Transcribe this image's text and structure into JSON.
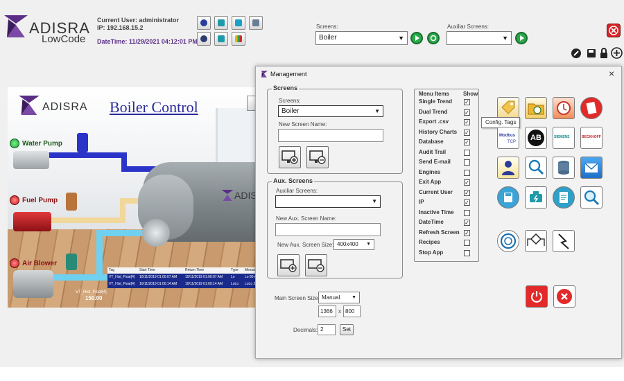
{
  "header": {
    "logo_text": "ADISRA",
    "logo_sub": "LowCode",
    "current_user": "Current User: administrator",
    "ip": "IP: 192.168.15.2",
    "datetime": "DateTime: 11/29/2021 04:12:01 PM"
  },
  "screens": {
    "label": "Screens:",
    "value": "Boiler"
  },
  "aux_screens": {
    "label": "Auxiliar Screens:",
    "value": ""
  },
  "canvas": {
    "logo_text": "ADISRA",
    "title": "Boiler Control",
    "water_pump": "Water Pump",
    "fuel_pump": "Fuel Pump",
    "air_blower": "Air Blower",
    "tank_logo": "ADIS",
    "table": {
      "headers": [
        "Tag",
        "Start Time",
        "Return Time",
        "Type",
        "Messa"
      ],
      "rows": [
        [
          "VT_Hist_Float[4]",
          "10/11/2019 01:00:07 AM",
          "10/11/2019 01:00:07 AM",
          "Lo",
          "Lo 80 A"
        ],
        [
          "VT_Hist_Float[4]",
          "10/11/2019 01:00:14 AM",
          "10/11/2019 01:00:14 AM",
          "LoLo",
          "LoLo 25"
        ]
      ]
    },
    "readout_tag": "VT_Hist_Float[4]",
    "readout_value": "150.00"
  },
  "dialog": {
    "title": "Management",
    "close": "×",
    "screens_group": {
      "title": "Screens",
      "label": "Screens:",
      "value": "Boiler",
      "new_name_label": "New Screen Name:",
      "new_name_value": ""
    },
    "aux_group": {
      "title": "Aux. Screens",
      "label": "Auxiliar Screens:",
      "value": "",
      "new_name_label": "New Aux. Screen Name:",
      "new_name_value": "",
      "size_label": "New Aux. Screen Size:",
      "size_value": "400x400"
    },
    "menu": {
      "header_items": "Menu Items",
      "header_show": "Show",
      "items": [
        {
          "label": "Single Trend",
          "mark": "✓"
        },
        {
          "label": "Dual Trend",
          "mark": "✓"
        },
        {
          "label": "Export .csv",
          "mark": "✓"
        },
        {
          "label": "History Charts",
          "mark": "✓"
        },
        {
          "label": "Database",
          "mark": "✓"
        },
        {
          "label": "Audit Trail",
          "mark": ""
        },
        {
          "label": "Send E-mail",
          "mark": ""
        },
        {
          "label": "Engines",
          "mark": ""
        },
        {
          "label": "Exit App",
          "mark": "✓"
        },
        {
          "label": "Current User",
          "mark": "✓"
        },
        {
          "label": "IP",
          "mark": "✓"
        },
        {
          "label": "Inactive Time",
          "mark": ""
        },
        {
          "label": "DateTime",
          "mark": "✓"
        },
        {
          "label": "Refresh Screen",
          "mark": "✓"
        },
        {
          "label": "Recipes",
          "mark": ""
        },
        {
          "label": "Stop App",
          "mark": ""
        }
      ]
    },
    "tooltip": "Config. Tags",
    "icons": {
      "ab": "AB",
      "modbus": "Modbus",
      "modbus_tcp": "TCP",
      "siemens": "SIEMENS",
      "beckhoff": "BECKHOFF"
    },
    "main_size": {
      "label": "Main Screen Size:",
      "mode": "Manual",
      "width": "1366",
      "x": "x",
      "height": "800"
    },
    "decimals": {
      "label": "Decimals:",
      "value": "2",
      "set": "Set"
    }
  },
  "colors": {
    "accent_purple": "#5b2d86",
    "title_blue": "#2a2a9a",
    "green": "#2aa84a",
    "red": "#d6262a"
  }
}
